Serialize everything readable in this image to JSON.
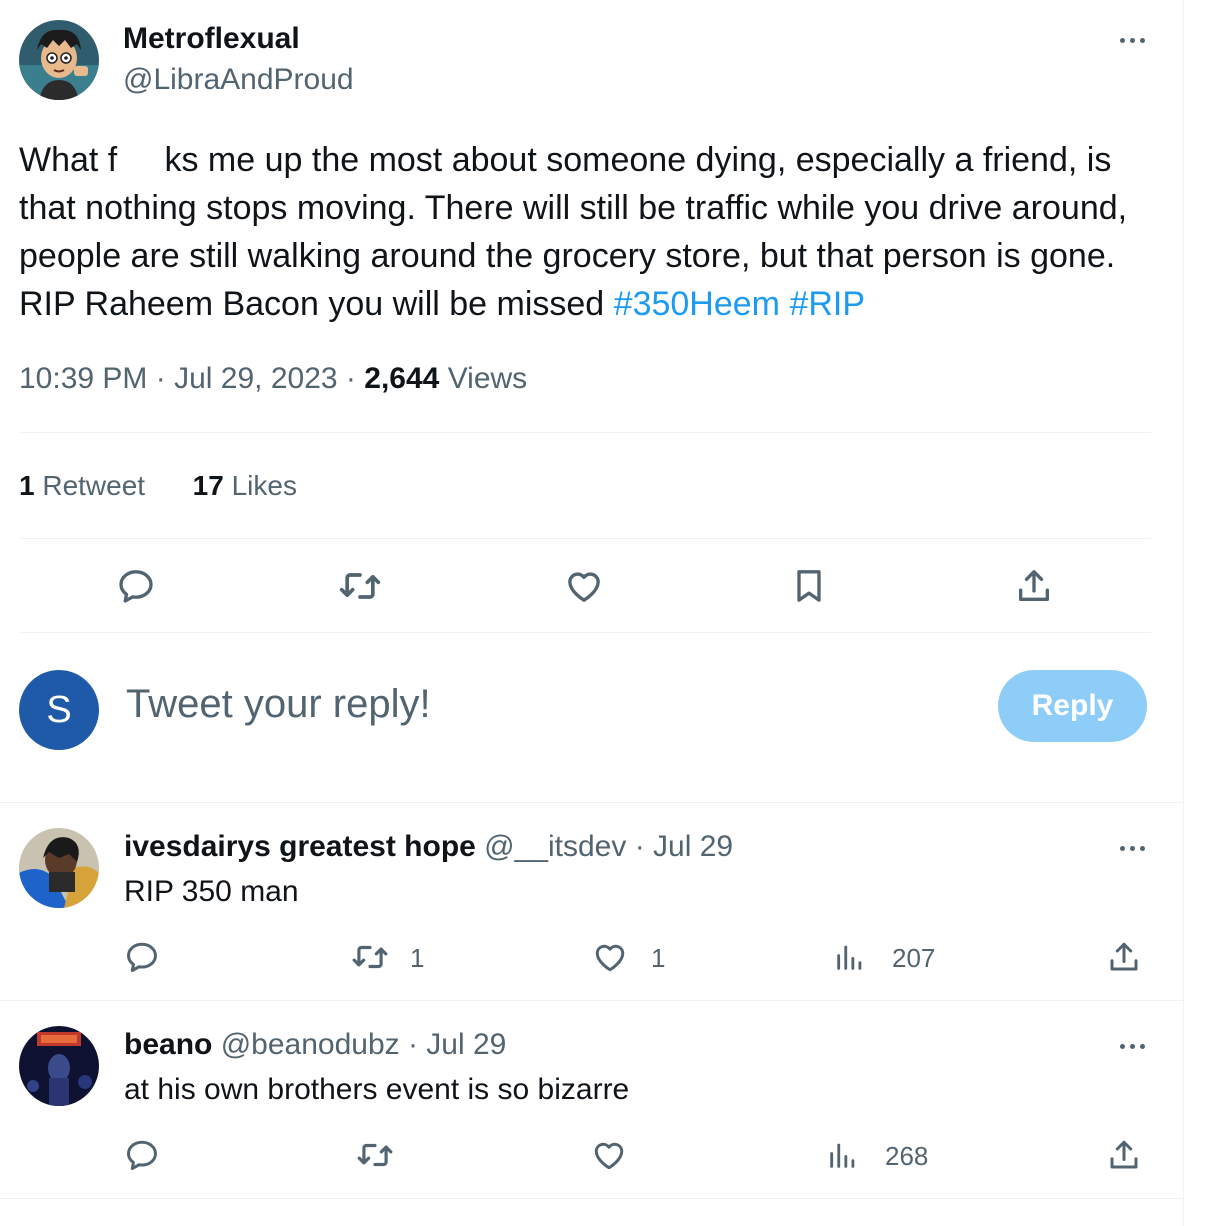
{
  "tweet": {
    "author_name": "Metroflexual",
    "author_handle": "@LibraAndProud",
    "text_before": "What f     ks me up the most about someone dying, especially a friend, is that nothing stops moving. There will still be traffic while you drive around, people are still walking around the grocery store, but that person is gone. RIP Raheem Bacon you will be missed",
    "hashtags": [
      "#350Heem",
      "#RIP"
    ],
    "time": "10:39 PM",
    "date": "Jul 29, 2023",
    "views_count": "2,644",
    "views_label": "Views",
    "retweets_count": "1",
    "retweets_label": "Retweet",
    "likes_count": "17",
    "likes_label": "Likes",
    "separator": "·"
  },
  "reply_box": {
    "avatar_letter": "S",
    "placeholder": "Tweet your reply!",
    "button_label": "Reply",
    "avatar_color": "#1f5aa8",
    "button_color": "#8ecdf7"
  },
  "replies": [
    {
      "name": "ivesdairys greatest hope",
      "handle": "@__itsdev",
      "date": "· Jul 29",
      "text": "RIP 350 man",
      "retweets": "1",
      "likes": "1",
      "views": "207"
    },
    {
      "name": "beano",
      "handle": "@beanodubz",
      "date": "· Jul 29",
      "text": "at his own brothers event is so bizarre",
      "retweets": "",
      "likes": "",
      "views": "268"
    }
  ],
  "icons": {
    "more": "more-icon",
    "reply": "reply-icon",
    "retweet": "retweet-icon",
    "like": "heart-icon",
    "bookmark": "bookmark-icon",
    "share": "share-icon",
    "views": "views-icon"
  },
  "colors": {
    "accent": "#1d9bf0",
    "muted": "#536471",
    "text": "#0f1419"
  }
}
